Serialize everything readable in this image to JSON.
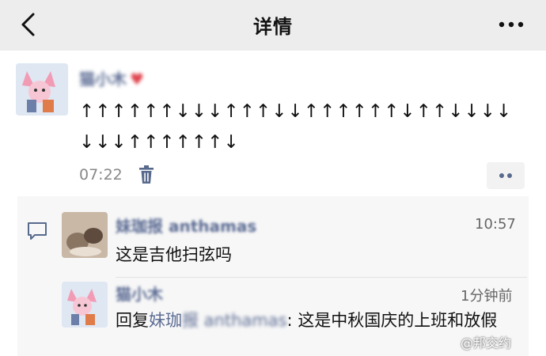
{
  "header": {
    "title": "详情"
  },
  "post": {
    "author": "猫小木",
    "text": "↑↑↑↑↑↑↓↓↓↑↑↑↓↓↑↑↑↑↑↑↓↑↑↓↓↓↓↓↓↓↑↑↑↑↑↑↓",
    "time": "07:22"
  },
  "comments": [
    {
      "author": "妹珈报 anthamas",
      "time": "10:57",
      "text": "这是吉他扫弦吗"
    },
    {
      "author": "猫小木",
      "time": "1分钟前",
      "reply_prefix": "回复",
      "reply_name": "妹珈",
      "reply_name_obscured": "报 anthamas",
      "reply_separator": ":",
      "reply_text": "这是中秋国庆的上班和放假"
    }
  ],
  "watermark": "@邦交约",
  "colors": {
    "header_bg": "#ededed",
    "link_blue": "#5b6b93",
    "comments_bg": "#f7f7f7"
  }
}
